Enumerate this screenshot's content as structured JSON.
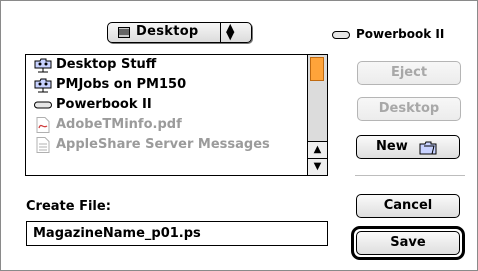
{
  "popup": {
    "label": "Desktop"
  },
  "volume": {
    "label": "Powerbook II"
  },
  "file_list": {
    "items": [
      {
        "label": "Desktop Stuff",
        "icon": "shared-folder-icon",
        "enabled": true
      },
      {
        "label": "PMJobs on PM150",
        "icon": "shared-folder-icon",
        "enabled": true
      },
      {
        "label": "Powerbook II",
        "icon": "drive-icon",
        "enabled": true
      },
      {
        "label": "AdobeTMinfo.pdf",
        "icon": "pdf-document-icon",
        "enabled": false
      },
      {
        "label": "AppleShare Server Messages",
        "icon": "text-document-icon",
        "enabled": false
      }
    ]
  },
  "buttons": {
    "eject": "Eject",
    "desktop": "Desktop",
    "new": "New",
    "cancel": "Cancel",
    "save": "Save"
  },
  "create_file": {
    "label": "Create File:",
    "value": "MagazineName_p01.ps"
  },
  "colors": {
    "scroll_thumb": "#ffa43a",
    "disabled_text": "#a8a8a8"
  }
}
